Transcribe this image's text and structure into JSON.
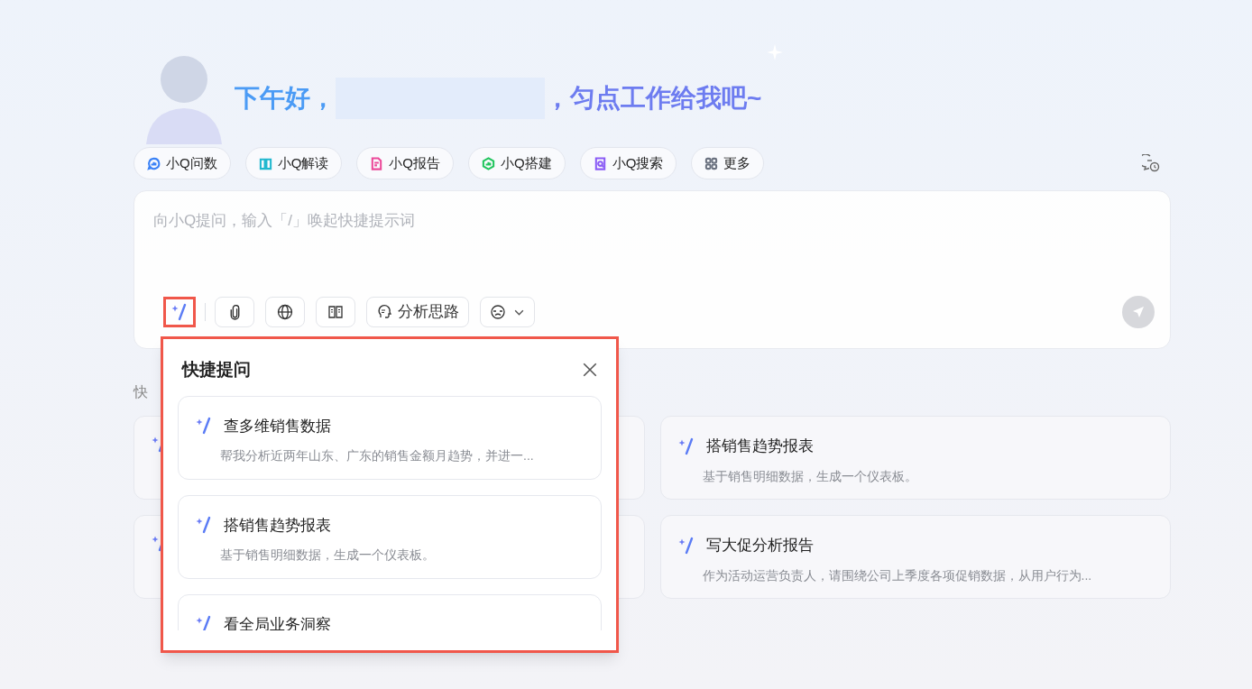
{
  "greeting": {
    "prefix": "下午好，",
    "suffix": "，匀点工作给我吧~"
  },
  "agents": [
    {
      "label": "小Q问数",
      "color": "#3b82f6"
    },
    {
      "label": "小Q解读",
      "color": "#22b8cf"
    },
    {
      "label": "小Q报告",
      "color": "#ec4899"
    },
    {
      "label": "小Q搭建",
      "color": "#22c55e"
    },
    {
      "label": "小Q搜索",
      "color": "#8b5cf6"
    },
    {
      "label": "更多",
      "color": "#6b7280"
    }
  ],
  "composer": {
    "placeholder": "向小Q提问，输入「/」唤起快捷提示词",
    "send_disabled": true,
    "tools": [
      {
        "kind": "prompt",
        "highlighted": true
      },
      {
        "kind": "attach"
      },
      {
        "kind": "web"
      },
      {
        "kind": "book"
      },
      {
        "kind": "thinking",
        "label": "分析思路"
      },
      {
        "kind": "model"
      }
    ]
  },
  "quick_section": {
    "label": "快",
    "cards": [
      {
        "kind": "covered"
      },
      {
        "kind": "prompt",
        "title": "搭销售趋势报表",
        "desc": "基于销售明细数据，生成一个仪表板。"
      },
      {
        "kind": "covered"
      },
      {
        "kind": "prompt",
        "title": "写大促分析报告",
        "desc": "作为活动运营负责人，请围绕公司上季度各项促销数据，从用户行为..."
      }
    ]
  },
  "popup": {
    "title": "快捷提问",
    "highlighted": true,
    "items": [
      {
        "title": "查多维销售数据",
        "desc": "帮我分析近两年山东、广东的销售金额月趋势，并进一..."
      },
      {
        "title": "搭销售趋势报表",
        "desc": "基于销售明细数据，生成一个仪表板。"
      },
      {
        "title": "看全局业务洞察"
      }
    ]
  }
}
